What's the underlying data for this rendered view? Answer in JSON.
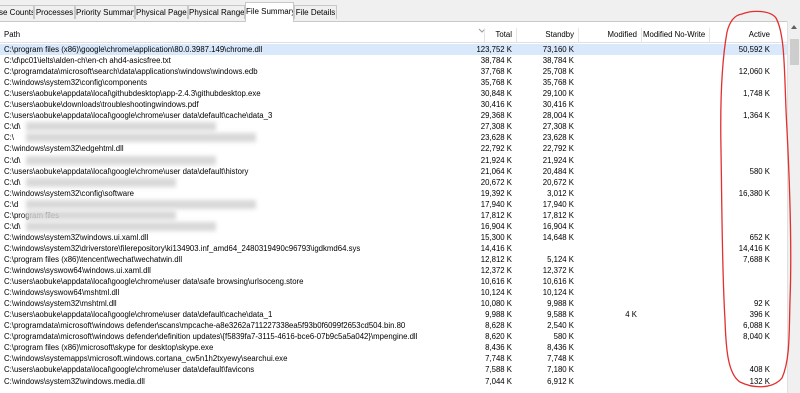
{
  "tabs": [
    {
      "label": "se Counts",
      "active": false
    },
    {
      "label": "Processes",
      "active": false
    },
    {
      "label": "Priority Summary",
      "active": false
    },
    {
      "label": "Physical Pages",
      "active": false
    },
    {
      "label": "Physical Ranges",
      "active": false
    },
    {
      "label": "File Summary",
      "active": true
    },
    {
      "label": "File Details",
      "active": false
    }
  ],
  "columns": {
    "path": "Path",
    "total": "Total",
    "standby": "Standby",
    "modified": "Modified",
    "modified_no_write": "Modified No-Write",
    "active": "Active"
  },
  "rows": [
    {
      "path": "C:\\program files (x86)\\google\\chrome\\application\\80.0.3987.149\\chrome.dll",
      "total": "123,752 K",
      "standby": "73,160 K",
      "modified": "",
      "modified_no_write": "",
      "active": "50,592 K"
    },
    {
      "path": "C:\\d\\pc01\\ielts\\alden-ch\\en-ch ahd4-asicsfree.txt",
      "total": "38,784 K",
      "standby": "38,784 K",
      "modified": "",
      "modified_no_write": "",
      "active": ""
    },
    {
      "path": "C:\\programdata\\microsoft\\search\\data\\applications\\windows\\windows.edb",
      "total": "37,768 K",
      "standby": "25,708 K",
      "modified": "",
      "modified_no_write": "",
      "active": "12,060 K"
    },
    {
      "path": "C:\\windows\\system32\\config\\components",
      "total": "35,768 K",
      "standby": "35,768 K",
      "modified": "",
      "modified_no_write": "",
      "active": ""
    },
    {
      "path": "C:\\users\\aobuke\\appdata\\local\\githubdesktop\\app-2.4.3\\githubdesktop.exe",
      "total": "30,848 K",
      "standby": "29,100 K",
      "modified": "",
      "modified_no_write": "",
      "active": "1,748 K"
    },
    {
      "path": "C:\\users\\aobuke\\downloads\\troubleshootingwindows.pdf",
      "total": "30,416 K",
      "standby": "30,416 K",
      "modified": "",
      "modified_no_write": "",
      "active": ""
    },
    {
      "path": "C:\\users\\aobuke\\appdata\\local\\google\\chrome\\user data\\default\\cache\\data_3",
      "total": "29,368 K",
      "standby": "28,004 K",
      "modified": "",
      "modified_no_write": "",
      "active": "1,364 K"
    },
    {
      "path": "C:\\d\\",
      "total": "27,308 K",
      "standby": "27,308 K",
      "modified": "",
      "modified_no_write": "",
      "active": "",
      "redacted": true
    },
    {
      "path": "C:\\",
      "total": "23,628 K",
      "standby": "23,628 K",
      "modified": "",
      "modified_no_write": "",
      "active": "",
      "redacted": true
    },
    {
      "path": "C:\\windows\\system32\\edgehtml.dll",
      "total": "22,792 K",
      "standby": "22,792 K",
      "modified": "",
      "modified_no_write": "",
      "active": ""
    },
    {
      "path": "C:\\d\\",
      "total": "21,924 K",
      "standby": "21,924 K",
      "modified": "",
      "modified_no_write": "",
      "active": "",
      "redacted": true
    },
    {
      "path": "C:\\users\\aobuke\\appdata\\local\\google\\chrome\\user data\\default\\history",
      "total": "21,064 K",
      "standby": "20,484 K",
      "modified": "",
      "modified_no_write": "",
      "active": "580 K"
    },
    {
      "path": "C:\\d\\",
      "total": "20,672 K",
      "standby": "20,672 K",
      "modified": "",
      "modified_no_write": "",
      "active": "",
      "redacted": true
    },
    {
      "path": "C:\\windows\\system32\\config\\software",
      "total": "19,392 K",
      "standby": "3,012 K",
      "modified": "",
      "modified_no_write": "",
      "active": "16,380 K"
    },
    {
      "path": "C:\\d",
      "total": "17,940 K",
      "standby": "17,940 K",
      "modified": "",
      "modified_no_write": "",
      "active": "",
      "redacted": true
    },
    {
      "path": "C:\\program files",
      "total": "17,812 K",
      "standby": "17,812 K",
      "modified": "",
      "modified_no_write": "",
      "active": "",
      "redacted": true
    },
    {
      "path": "C:\\d\\",
      "total": "16,904 K",
      "standby": "16,904 K",
      "modified": "",
      "modified_no_write": "",
      "active": "",
      "redacted": true
    },
    {
      "path": "C:\\windows\\system32\\windows.ui.xaml.dll",
      "total": "15,300 K",
      "standby": "14,648 K",
      "modified": "",
      "modified_no_write": "",
      "active": "652 K"
    },
    {
      "path": "C:\\windows\\system32\\driverstore\\filerepository\\ki134903.inf_amd64_2480319490c96793\\igdkmd64.sys",
      "total": "14,416 K",
      "standby": "",
      "modified": "",
      "modified_no_write": "",
      "active": "14,416 K"
    },
    {
      "path": "C:\\program files (x86)\\tencent\\wechat\\wechatwin.dll",
      "total": "12,812 K",
      "standby": "5,124 K",
      "modified": "",
      "modified_no_write": "",
      "active": "7,688 K"
    },
    {
      "path": "C:\\windows\\syswow64\\windows.ui.xaml.dll",
      "total": "12,372 K",
      "standby": "12,372 K",
      "modified": "",
      "modified_no_write": "",
      "active": ""
    },
    {
      "path": "C:\\users\\aobuke\\appdata\\local\\google\\chrome\\user data\\safe browsing\\urlsoceng.store",
      "total": "10,616 K",
      "standby": "10,616 K",
      "modified": "",
      "modified_no_write": "",
      "active": ""
    },
    {
      "path": "C:\\windows\\syswow64\\mshtml.dll",
      "total": "10,124 K",
      "standby": "10,124 K",
      "modified": "",
      "modified_no_write": "",
      "active": ""
    },
    {
      "path": "C:\\windows\\system32\\mshtml.dll",
      "total": "10,080 K",
      "standby": "9,988 K",
      "modified": "",
      "modified_no_write": "",
      "active": "92 K"
    },
    {
      "path": "C:\\users\\aobuke\\appdata\\local\\google\\chrome\\user data\\default\\cache\\data_1",
      "total": "9,988 K",
      "standby": "9,588 K",
      "modified": "4 K",
      "modified_no_write": "",
      "active": "396 K"
    },
    {
      "path": "C:\\programdata\\microsoft\\windows defender\\scans\\mpcache-a8e3262a711227338ea5f93b0f6099f2653cd504.bin.80",
      "total": "8,628 K",
      "standby": "2,540 K",
      "modified": "",
      "modified_no_write": "",
      "active": "6,088 K"
    },
    {
      "path": "C:\\programdata\\microsoft\\windows defender\\definition updates\\{f5839fa7-3115-4616-bce6-07b9c5a5a042}\\mpengine.dll",
      "total": "8,620 K",
      "standby": "580 K",
      "modified": "",
      "modified_no_write": "",
      "active": "8,040 K"
    },
    {
      "path": "C:\\program files (x86)\\microsoft\\skype for desktop\\skype.exe",
      "total": "8,436 K",
      "standby": "8,436 K",
      "modified": "",
      "modified_no_write": "",
      "active": ""
    },
    {
      "path": "C:\\windows\\systemapps\\microsoft.windows.cortana_cw5n1h2txyewy\\searchui.exe",
      "total": "7,748 K",
      "standby": "7,748 K",
      "modified": "",
      "modified_no_write": "",
      "active": ""
    },
    {
      "path": "C:\\users\\aobuke\\appdata\\local\\google\\chrome\\user data\\default\\favicons",
      "total": "7,588 K",
      "standby": "7,180 K",
      "modified": "",
      "modified_no_write": "",
      "active": "408 K"
    },
    {
      "path": "C:\\windows\\system32\\windows.media.dll",
      "total": "7,044 K",
      "standby": "6,912 K",
      "modified": "",
      "modified_no_write": "",
      "active": "132 K"
    }
  ],
  "annotation_color": "#e03030",
  "selected_row_color": "#d9e8fb"
}
